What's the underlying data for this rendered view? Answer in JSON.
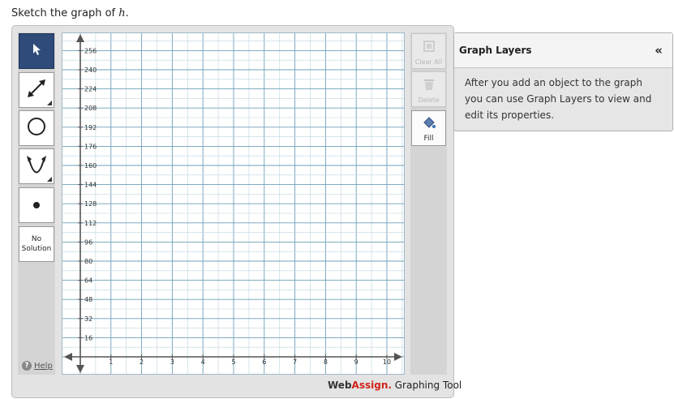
{
  "prompt": {
    "text": "Sketch the graph of",
    "variable": "h",
    "end": "."
  },
  "toolbar": {
    "tools": [
      {
        "name": "pointer-tool",
        "icon": "arrow-cursor-icon",
        "selected": true
      },
      {
        "name": "line-tool",
        "icon": "line-segment-icon"
      },
      {
        "name": "circle-tool",
        "icon": "circle-icon"
      },
      {
        "name": "parabola-tool",
        "icon": "parabola-icon"
      },
      {
        "name": "point-tool",
        "icon": "point-icon"
      }
    ],
    "no_solution_line1": "No",
    "no_solution_line2": "Solution",
    "help_label": "Help"
  },
  "graph": {
    "x_ticks": [
      "1",
      "2",
      "3",
      "4",
      "5",
      "6",
      "7",
      "8",
      "9",
      "10"
    ],
    "y_ticks": [
      "16",
      "32",
      "48",
      "64",
      "80",
      "96",
      "112",
      "128",
      "144",
      "160",
      "176",
      "192",
      "208",
      "224",
      "240",
      "256"
    ],
    "grid_color": "#6fa0b8",
    "axis_color": "#555555"
  },
  "side_buttons": {
    "clear_all": "Clear All",
    "delete": "Delete",
    "fill": "Fill"
  },
  "branding": {
    "web": "Web",
    "assign": "Assign.",
    "rest": " Graphing Tool"
  },
  "layers_panel": {
    "title": "Graph Layers",
    "collapse": "«",
    "body": "After you add an object to the graph you can use Graph Layers to view and edit its properties."
  },
  "colors": {
    "selected_tool": "#2f4b79",
    "brand_red": "#d0241b"
  }
}
